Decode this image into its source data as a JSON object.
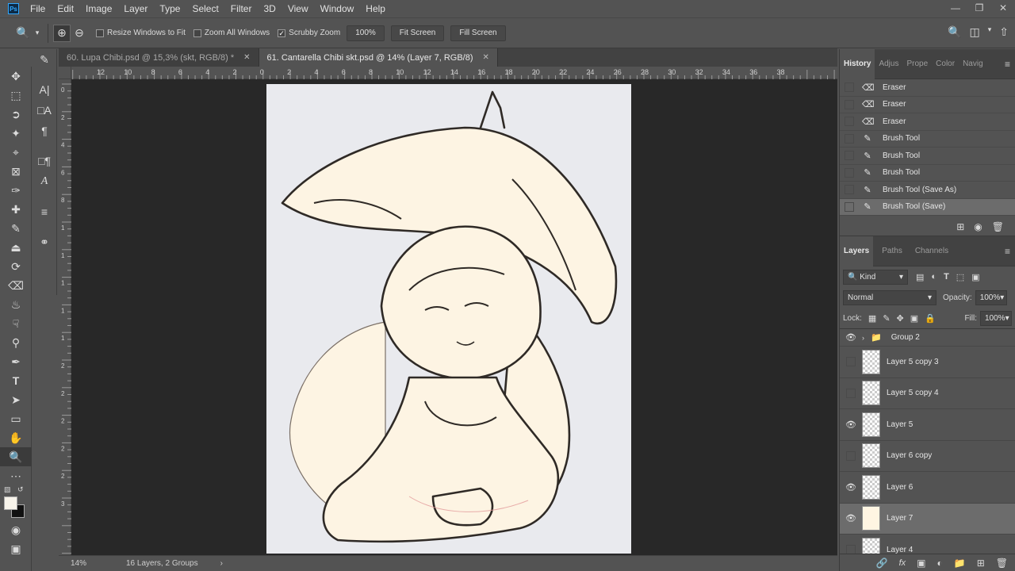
{
  "menu": [
    "File",
    "Edit",
    "Image",
    "Layer",
    "Type",
    "Select",
    "Filter",
    "3D",
    "View",
    "Window",
    "Help"
  ],
  "app_logo": "Ps",
  "window_controls": {
    "minimize": "—",
    "restore": "❐",
    "close": "✕"
  },
  "options": {
    "resize_windows": "Resize Windows to Fit",
    "zoom_all": "Zoom All Windows",
    "scrubby_zoom": "Scrubby Zoom",
    "zoom_value": "100%",
    "fit_screen": "Fit Screen",
    "fill_screen": "Fill Screen"
  },
  "doc_tabs": [
    {
      "label": "60. Lupa Chibi.psd @ 15,3% (skt, RGB/8) *",
      "active": false
    },
    {
      "label": "61. Cantarella Chibi skt.psd @ 14% (Layer 7, RGB/8)",
      "active": true
    }
  ],
  "hruler_labels": [
    "12",
    "10",
    "8",
    "6",
    "4",
    "2",
    "0",
    "2",
    "4",
    "6",
    "8",
    "10",
    "12",
    "14",
    "16",
    "18",
    "20",
    "22",
    "24",
    "26",
    "28",
    "30",
    "32",
    "34",
    "36",
    "38"
  ],
  "vruler_labels": [
    "0",
    "2",
    "4",
    "6",
    "8",
    "1",
    "1",
    "1",
    "1",
    "1",
    "2",
    "2",
    "2",
    "2",
    "2",
    "3"
  ],
  "status": {
    "zoom": "14%",
    "info": "16 Layers, 2 Groups",
    "arrow": "›"
  },
  "history_tabs": [
    "History",
    "Adjus",
    "Prope",
    "Color",
    "Navig"
  ],
  "history": [
    {
      "label": "Eraser",
      "icon": "eraser-icon"
    },
    {
      "label": "Eraser",
      "icon": "eraser-icon"
    },
    {
      "label": "Eraser",
      "icon": "eraser-icon"
    },
    {
      "label": "Brush Tool",
      "icon": "brush-icon"
    },
    {
      "label": "Brush Tool",
      "icon": "brush-icon"
    },
    {
      "label": "Brush Tool",
      "icon": "brush-icon"
    },
    {
      "label": "Brush Tool (Save As)",
      "icon": "brush-icon"
    },
    {
      "label": "Brush Tool (Save)",
      "icon": "brush-icon",
      "selected": true
    }
  ],
  "layers_tabs": [
    "Layers",
    "Paths",
    "Channels"
  ],
  "layers_panel": {
    "filter": "Kind",
    "blend": "Normal",
    "opacity_label": "Opacity:",
    "opacity": "100%",
    "lock_label": "Lock:",
    "fill_label": "Fill:",
    "fill": "100%"
  },
  "layers": [
    {
      "name": "Group 2",
      "visible": true,
      "group": true
    },
    {
      "name": "Layer 5  copy 3",
      "visible": false
    },
    {
      "name": "Layer 5  copy 4",
      "visible": false
    },
    {
      "name": "Layer 5",
      "visible": true
    },
    {
      "name": "Layer 6 copy",
      "visible": false
    },
    {
      "name": "Layer 6",
      "visible": true
    },
    {
      "name": "Layer 7",
      "visible": true,
      "selected": true,
      "solid": true
    },
    {
      "name": "Layer 4",
      "visible": false
    }
  ]
}
